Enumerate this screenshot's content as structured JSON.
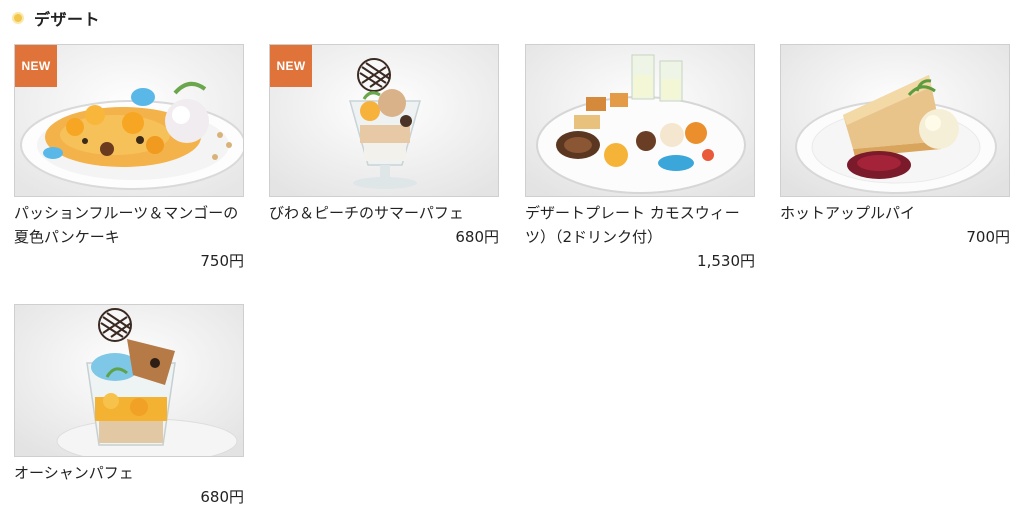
{
  "section": {
    "title": "デザート"
  },
  "badges": {
    "new": "NEW"
  },
  "items": [
    {
      "name": "パッションフルーツ＆マンゴーの夏色パンケーキ",
      "price": "750円",
      "is_new": true
    },
    {
      "name": "びわ＆ピーチのサマーパフェ",
      "price": "680円",
      "is_new": true
    },
    {
      "name": "デザートプレート カモスウィーツ）（2ドリンク付）",
      "price": "1,530円",
      "is_new": false
    },
    {
      "name": "ホットアップルパイ",
      "price": "700円",
      "is_new": false
    },
    {
      "name": "オーシャンパフェ",
      "price": "680円",
      "is_new": false
    }
  ],
  "colors": {
    "accent_badge": "#e0733a",
    "section_dot": "#f2c64a"
  }
}
